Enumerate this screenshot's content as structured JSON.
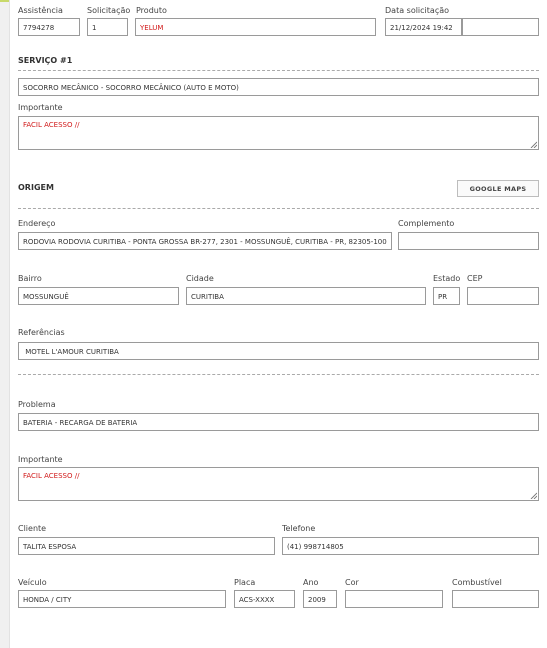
{
  "header": {
    "assistencia_label": "Assistência",
    "assistencia_value": "7794278",
    "solicitacao_label": "Solicitação",
    "solicitacao_value": "1",
    "produto_label": "Produto",
    "produto_value": "YELUM",
    "data_solicitacao_label": "Data solicitação",
    "data_solicitacao_value": "21/12/2024 19:42",
    "extra_value": ""
  },
  "servico": {
    "title": "SERVIÇO #1",
    "value": "SOCORRO MECÂNICO - SOCORRO MECÂNICO (AUTO E MOTO)",
    "importante_label": "Importante",
    "importante_value": "FACIL ACESSO //"
  },
  "origem": {
    "title": "ORIGEM",
    "google_maps_button": "GOOGLE MAPS",
    "endereco_label": "Endereço",
    "endereco_value": "RODOVIA RODOVIA CURITIBA - PONTA GROSSA BR-277, 2301 - MOSSUNGUÊ, CURITIBA - PR, 82305-100",
    "complemento_label": "Complemento",
    "complemento_value": "",
    "bairro_label": "Bairro",
    "bairro_value": "MOSSUNGUÊ",
    "cidade_label": "Cidade",
    "cidade_value": "CURITIBA",
    "estado_label": "Estado",
    "estado_value": "PR",
    "cep_label": "CEP",
    "cep_value": "",
    "referencias_label": "Referências",
    "referencias_value": " MOTEL L'AMOUR CURITIBA"
  },
  "problema": {
    "problema_label": "Problema",
    "problema_value": "BATERIA - RECARGA DE BATERIA",
    "importante_label": "Importante",
    "importante_value": "FACIL ACESSO //"
  },
  "cliente": {
    "cliente_label": "Cliente",
    "cliente_value": "TALITA ESPOSA",
    "telefone_label": "Telefone",
    "telefone_value": "(41) 998714805"
  },
  "veiculo": {
    "veiculo_label": "Veículo",
    "veiculo_value": "HONDA / CITY",
    "placa_label": "Placa",
    "placa_value": "ACS-XXXX",
    "ano_label": "Ano",
    "ano_value": "2009",
    "cor_label": "Cor",
    "cor_value": "",
    "combustivel_label": "Combustível",
    "combustivel_value": ""
  },
  "colors": {
    "accent_line": "#c8d96a",
    "highlight_text": "#d11a1a"
  },
  "icons": {
    "resize": "textarea-resize-grip-icon"
  }
}
